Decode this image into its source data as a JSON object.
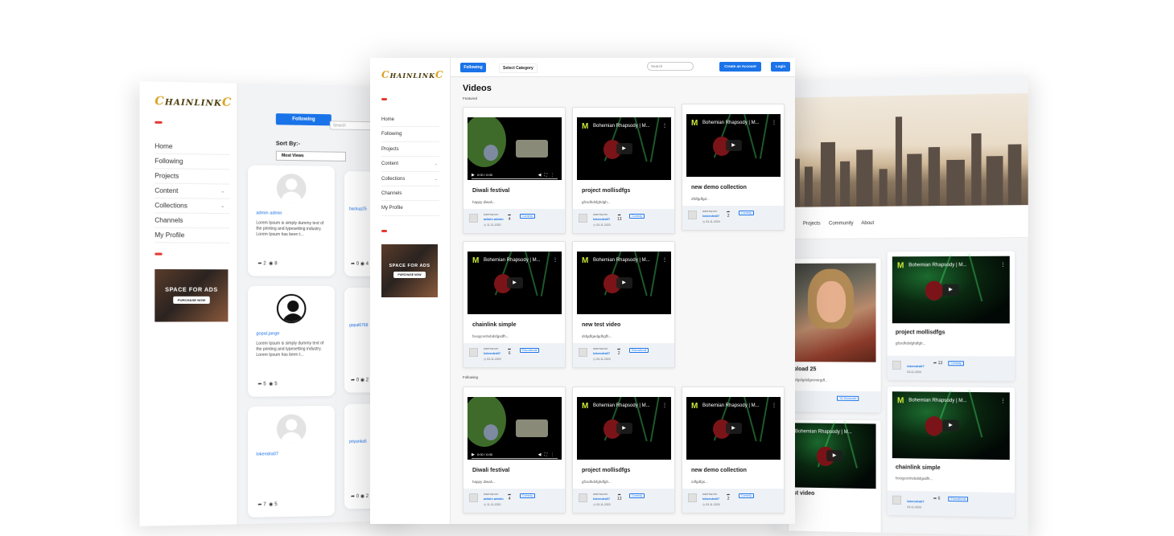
{
  "brand": {
    "logo_text": "HAINLINK"
  },
  "left": {
    "nav": [
      "Home",
      "Following",
      "Projects",
      "Content",
      "Collections",
      "Channels",
      "My Profile"
    ],
    "ad": {
      "title": "SPACE FOR ADS",
      "button": "PURCHASE NOW"
    },
    "following_button": "Following",
    "search_placeholder": "Search",
    "sort_label": "Sort By:-",
    "sort_value": "Most Views",
    "profiles": [
      {
        "name": "admin admin",
        "desc": "Lorem Ipsum is simply dummy text of the printing and typesetting industry. Lorem Ipsum has been t...",
        "shares": "2",
        "views": "8"
      },
      {
        "name": "gopal.jange",
        "desc": "Lorem Ipsum is simply dummy text of the printing and typesetting industry. Lorem Ipsum has been t...",
        "shares": "5",
        "views": "5"
      },
      {
        "name": "lokendra07",
        "desc": "",
        "shares": "7",
        "views": "5"
      }
    ],
    "side_profiles": [
      {
        "name": "backup25",
        "shares": "0",
        "views": "4"
      },
      {
        "name": "gopal6768",
        "shares": "0",
        "views": "2"
      },
      {
        "name": "priyanka5",
        "shares": "0",
        "views": "2"
      }
    ]
  },
  "center": {
    "nav": [
      "Home",
      "Following",
      "Projects",
      "Content",
      "Collections",
      "Channels",
      "My Profile"
    ],
    "ad": {
      "title": "SPACE FOR ADS",
      "button": "PURCHASE NOW"
    },
    "topbar": {
      "following": "Following",
      "category": "Select Category",
      "search_placeholder": "Search",
      "create": "Create an Account",
      "login": "Login"
    },
    "heading": "Videos",
    "section_featured": "Featured",
    "section_following": "Following",
    "written_by": "WRITTEN BY",
    "video_time": "0:00 / 0:05",
    "featured": [
      {
        "title": "Diwali festival",
        "desc": "happy diwali...",
        "author": "admin admin",
        "date": "11-11-2020",
        "shares": "4",
        "tag": "Comedy",
        "thumb": "bunny"
      },
      {
        "title": "project mollisdfgs",
        "desc": "gfzxdhdsfghdgh...",
        "author": "lokendra07",
        "date": "03-11-2020",
        "shares": "13",
        "tag": "Comedy",
        "thumb": "concert"
      },
      {
        "title": "new demo collection",
        "desc": "Zfdfgdfgd...",
        "author": "lokendra07",
        "date": "03-11-2020",
        "shares": "2",
        "tag": "Comedy",
        "thumb": "concert"
      },
      {
        "title": "chainlink simple",
        "desc": "fxxxgcvnhvbdsfgsdfh...",
        "author": "lokendra07",
        "date": "03-11-2020",
        "shares": "6",
        "tag": "Educational",
        "thumb": "concert"
      },
      {
        "title": "new test video",
        "desc": "dsfgdfgedgdhgfh...",
        "author": "lokendra07",
        "date": "03-11-2020",
        "shares": "2",
        "tag": "Educational",
        "thumb": "concert"
      }
    ],
    "following": [
      {
        "title": "Diwali festival",
        "desc": "happy diwali...",
        "author": "admin admin",
        "date": "11-11-2020",
        "shares": "4",
        "tag": "Comedy",
        "thumb": "bunny"
      },
      {
        "title": "project mollisdfgs",
        "desc": "gfzxdhdsfghdfgh...",
        "author": "lokendra07",
        "date": "03-11-2020",
        "shares": "13",
        "tag": "Comedy",
        "thumb": "concert"
      },
      {
        "title": "new demo collection",
        "desc": "zdfgdfgs...",
        "author": "lokendra07",
        "date": "03-11-2020",
        "shares": "2",
        "tag": "Comedy",
        "thumb": "concert"
      }
    ],
    "video_overlay_title": "Bohemian Rhapsody | M..."
  },
  "right": {
    "nav": [
      "Projects",
      "Community",
      "About"
    ],
    "cards": [
      {
        "title": "project mollisdfgs",
        "desc": "gfzxdhdsfghdfgh...",
        "author": "lokendra07",
        "date": "03-11-2020",
        "shares": "13",
        "tag": "Comedy"
      },
      {
        "title": "chainlink simple",
        "desc": "fxxxgcvnhvbdsfgsdfh...",
        "author": "lokendra07",
        "date": "03-11-2020",
        "shares": "6",
        "tag": "Educational"
      }
    ],
    "partial_cards": [
      {
        "title": "pload 25",
        "desc": "fsfgsfgdsfgesrwrgdf...",
        "tag": "Y6 Showcase"
      },
      {
        "title": "st video",
        "desc": ""
      }
    ]
  },
  "colors": {
    "accent": "#1a73e8",
    "brand_gold": "#d8a420",
    "red": "#e53935"
  }
}
